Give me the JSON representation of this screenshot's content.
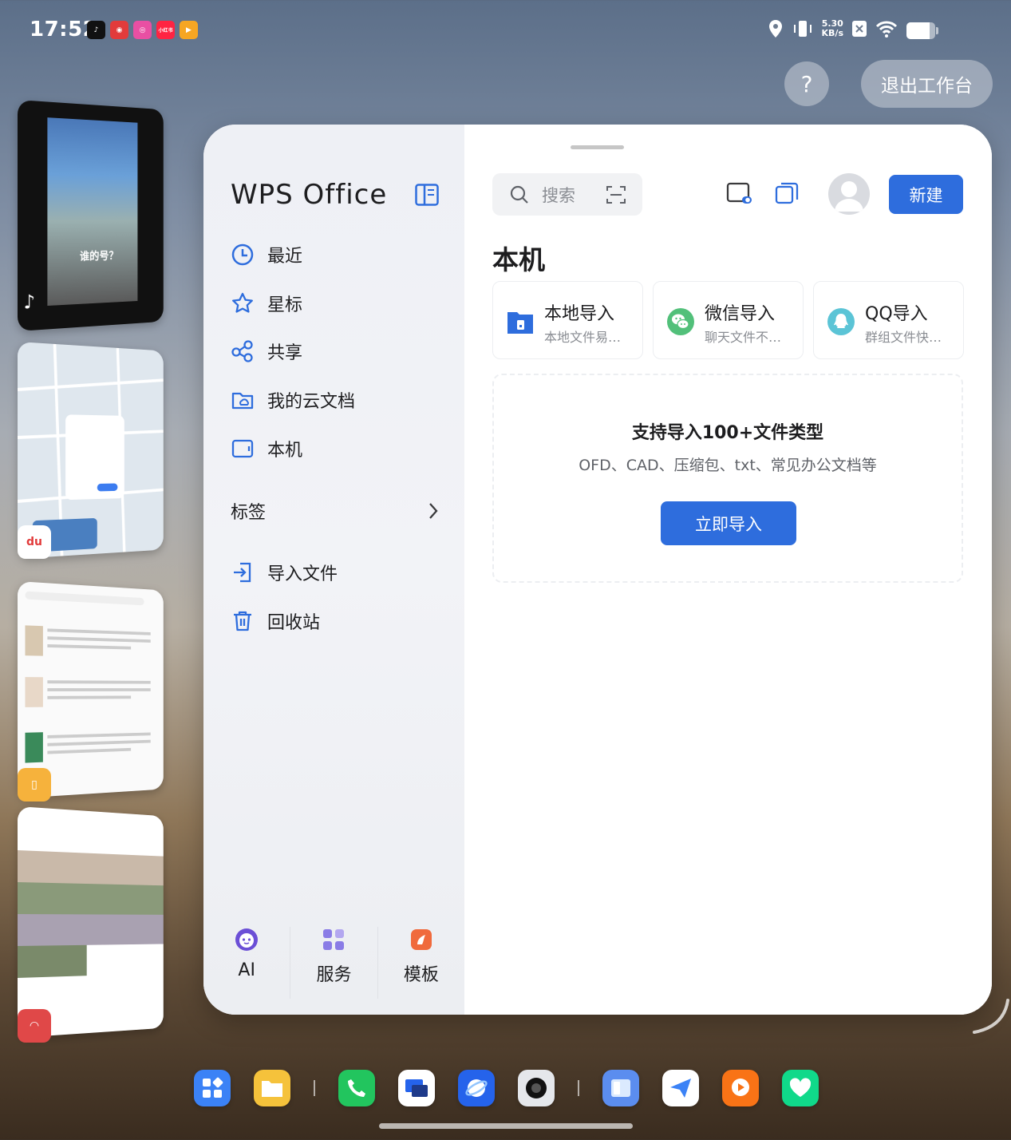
{
  "status_bar": {
    "time": "17:52",
    "net_speed_value": "5.30",
    "net_speed_unit": "KB/s",
    "battery_level": 0.8,
    "notification_apps": [
      "douyin-icon",
      "baidu-maps-icon",
      "camera-app-icon",
      "xiaohongshu-icon",
      "video-app-icon"
    ],
    "notification_labels": {
      "xiaohongshu": "小红书"
    }
  },
  "workspace": {
    "help_label": "?",
    "exit_label": "退出工作台"
  },
  "recent_apps": [
    {
      "name": "douyin",
      "caption": "谁的号？"
    },
    {
      "name": "baidu-maps",
      "badge": "du"
    },
    {
      "name": "reader"
    },
    {
      "name": "photos"
    }
  ],
  "wps": {
    "logo": "WPS Office",
    "nav": [
      {
        "label": "最近",
        "icon": "clock-icon"
      },
      {
        "label": "星标",
        "icon": "star-icon"
      },
      {
        "label": "共享",
        "icon": "share-icon"
      },
      {
        "label": "我的云文档",
        "icon": "cloud-folder-icon"
      },
      {
        "label": "本机",
        "icon": "tablet-icon"
      }
    ],
    "tags_label": "标签",
    "actions": [
      {
        "label": "导入文件",
        "icon": "import-icon"
      },
      {
        "label": "回收站",
        "icon": "trash-icon"
      }
    ],
    "bottom_tabs": [
      {
        "label": "AI",
        "icon": "ai-icon"
      },
      {
        "label": "服务",
        "icon": "services-icon"
      },
      {
        "label": "模板",
        "icon": "template-icon"
      }
    ],
    "search_placeholder": "搜索",
    "new_button": "新建",
    "page_title": "本机",
    "import_cards": [
      {
        "title": "本地导入",
        "subtitle": "本地文件易…",
        "icon": "folder-icon"
      },
      {
        "title": "微信导入",
        "subtitle": "聊天文件不…",
        "icon": "wechat-icon"
      },
      {
        "title": "QQ导入",
        "subtitle": "群组文件快…",
        "icon": "qq-icon"
      }
    ],
    "drop_title": "支持导入100+文件类型",
    "drop_subtitle": "OFD、CAD、压缩包、txt、常见办公文档等",
    "import_now": "立即导入"
  },
  "colors": {
    "accent": "#2e6ddd",
    "wechat": "#52c07a",
    "qq": "#5bc4d6"
  },
  "dock": [
    "apps-grid-icon",
    "files-icon",
    "phone-icon",
    "screen-cast-icon",
    "browser-icon",
    "camera-icon",
    "notes-icon",
    "mail-icon",
    "video-player-icon",
    "health-icon"
  ]
}
